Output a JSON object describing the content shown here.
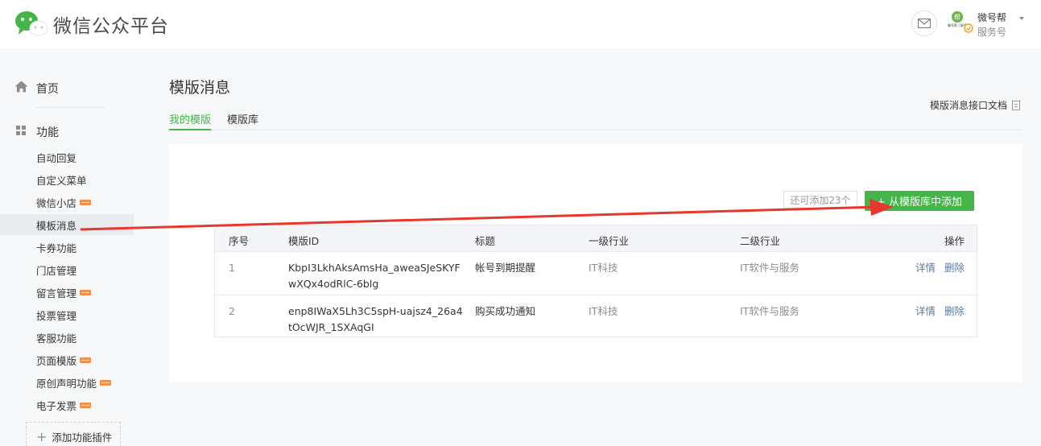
{
  "header": {
    "logo_title": "微信公众平台",
    "account_name": "微号帮",
    "account_type": "服务号",
    "avatar_text": "帮",
    "avatar_caption": "微号帮 | 助手"
  },
  "sidebar": {
    "home_label": "首页",
    "func_label": "功能",
    "items": [
      {
        "label": "自动回复",
        "badge": false,
        "active": false
      },
      {
        "label": "自定义菜单",
        "badge": false,
        "active": false
      },
      {
        "label": "微信小店",
        "badge": true,
        "active": false
      },
      {
        "label": "模板消息",
        "badge": false,
        "active": true
      },
      {
        "label": "卡券功能",
        "badge": false,
        "active": false
      },
      {
        "label": "门店管理",
        "badge": false,
        "active": false
      },
      {
        "label": "留言管理",
        "badge": true,
        "active": false
      },
      {
        "label": "投票管理",
        "badge": false,
        "active": false
      },
      {
        "label": "客服功能",
        "badge": false,
        "active": false
      },
      {
        "label": "页面模版",
        "badge": true,
        "active": false
      },
      {
        "label": "原创声明功能",
        "badge": true,
        "active": false
      },
      {
        "label": "电子发票",
        "badge": true,
        "active": false
      }
    ],
    "add_plugin_label": "添加功能插件"
  },
  "main": {
    "page_title": "模版消息",
    "doc_link": "模版消息接口文档",
    "tabs": [
      {
        "label": "我的模版",
        "active": true
      },
      {
        "label": "模版库",
        "active": false
      }
    ],
    "remain_text": "还可添加23个",
    "add_button": "+ 从模版库中添加",
    "table": {
      "headers": [
        "序号",
        "模版ID",
        "标题",
        "一级行业",
        "二级行业",
        "操作"
      ],
      "rows": [
        {
          "index": "1",
          "id_line1": "KbpI3LkhAksAmsHa_aweaSJeSKYF",
          "id_line2": "wXQx4odRlC-6blg",
          "title": "帐号到期提醒",
          "industry1": "IT科技",
          "industry2": "IT软件与服务",
          "detail": "详情",
          "delete": "删除"
        },
        {
          "index": "2",
          "id_line1": "enp8IWaX5Lh3C5spH-uajsz4_26a4",
          "id_line2": "tOcWJR_1SXAqGI",
          "title": "购买成功通知",
          "industry1": "IT科技",
          "industry2": "IT软件与服务",
          "detail": "详情",
          "delete": "删除"
        }
      ]
    }
  },
  "colors": {
    "brand_green": "#44b549",
    "annotation_red": "#e8372c",
    "badge_orange": "#f2904b"
  }
}
